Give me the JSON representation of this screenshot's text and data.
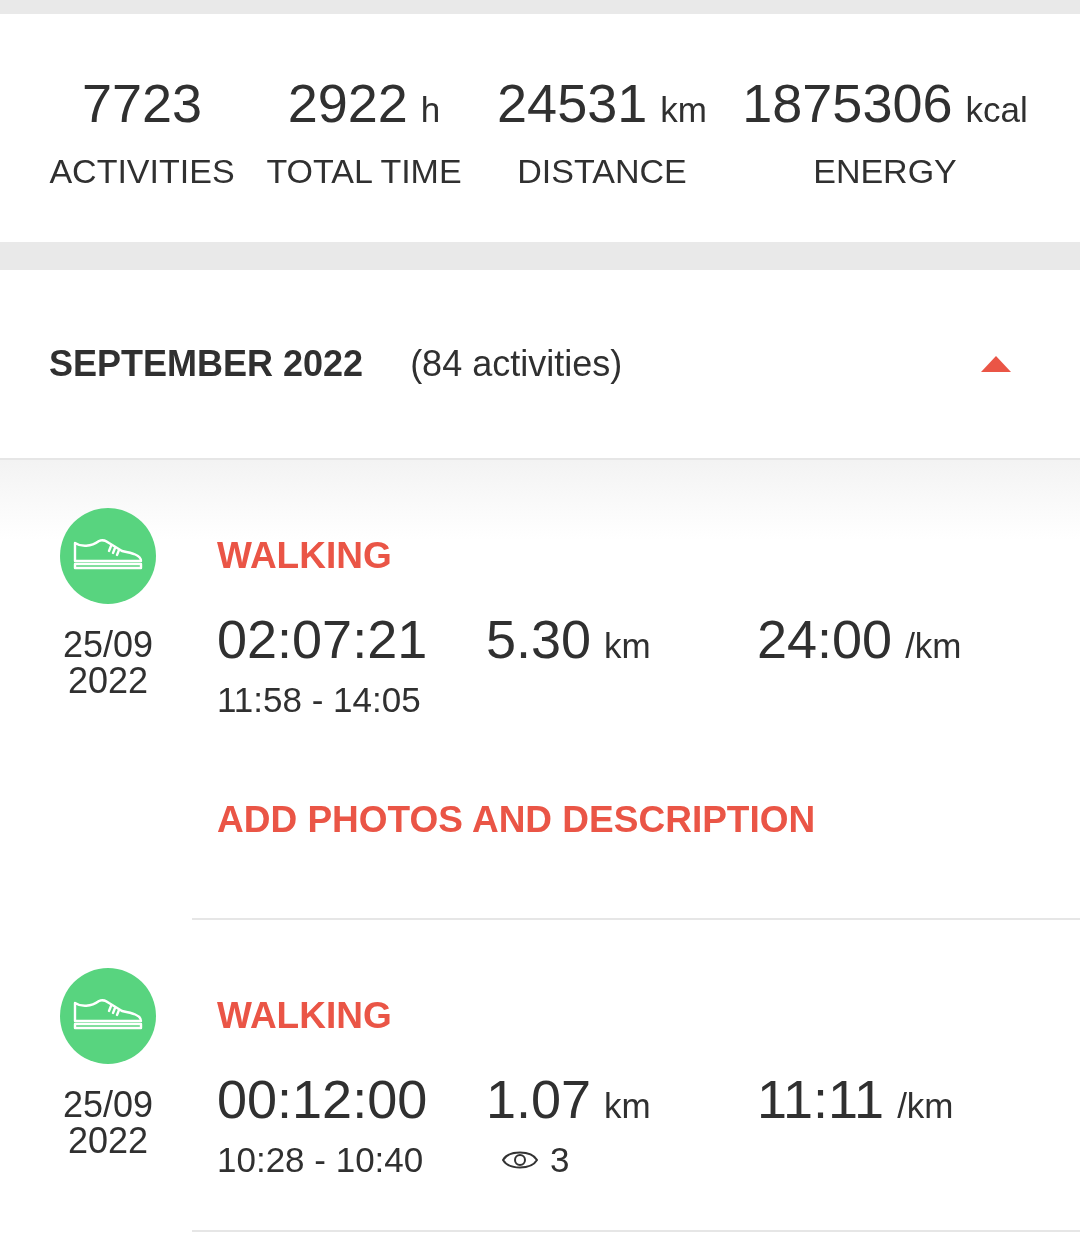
{
  "stats": [
    {
      "value": "7723",
      "label": "ACTIVITIES"
    },
    {
      "value": "2922",
      "unit": "h",
      "label": "TOTAL TIME"
    },
    {
      "value": "24531",
      "unit": "km",
      "label": "DISTANCE"
    },
    {
      "value": "1875306",
      "unit": "kcal",
      "label": "ENERGY"
    }
  ],
  "month": {
    "title": "SEPTEMBER 2022",
    "count": "(84 activities)",
    "expanded": true
  },
  "activities": [
    {
      "type": "WALKING",
      "date": "25/09",
      "year": "2022",
      "duration": "02:07:21",
      "distance": "5.30",
      "distance_unit": "km",
      "pace": "24:00",
      "pace_unit": "/km",
      "time_range": "11:58 - 14:05",
      "action": "ADD PHOTOS AND DESCRIPTION"
    },
    {
      "type": "WALKING",
      "date": "25/09",
      "year": "2022",
      "duration": "00:12:00",
      "distance": "1.07",
      "distance_unit": "km",
      "pace": "11:11",
      "pace_unit": "/km",
      "time_range": "10:28 - 10:40",
      "views": "3"
    }
  ]
}
